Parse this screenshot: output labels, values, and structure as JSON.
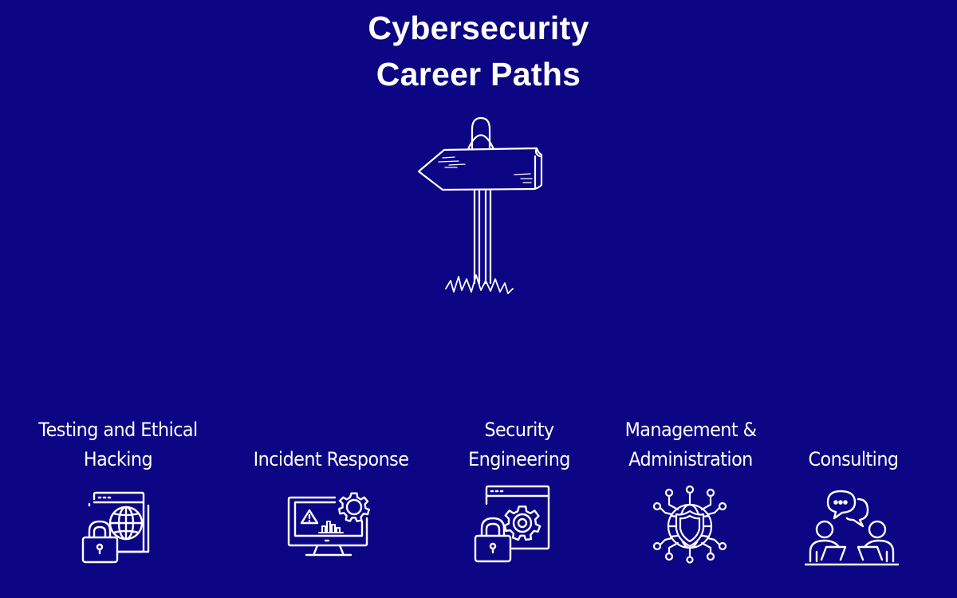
{
  "title": {
    "line1": "Cybersecurity",
    "line2": "Career Paths"
  },
  "colors": {
    "background": "#0c0684",
    "foreground": "#ffffff"
  },
  "hero_icon": "signpost-icon",
  "paths": [
    {
      "line1": "Testing and Ethical",
      "line2": "Hacking",
      "icon": "lock-browser-globe-icon"
    },
    {
      "line1": "",
      "line2": "Incident Response",
      "icon": "monitor-alert-gear-icon"
    },
    {
      "line1": "Security",
      "line2": "Engineering",
      "icon": "lock-browser-gear-icon"
    },
    {
      "line1": "Management &",
      "line2": "Administration",
      "icon": "network-shield-globe-icon"
    },
    {
      "line1": "",
      "line2": "Consulting",
      "icon": "consulting-people-chat-icon"
    }
  ]
}
